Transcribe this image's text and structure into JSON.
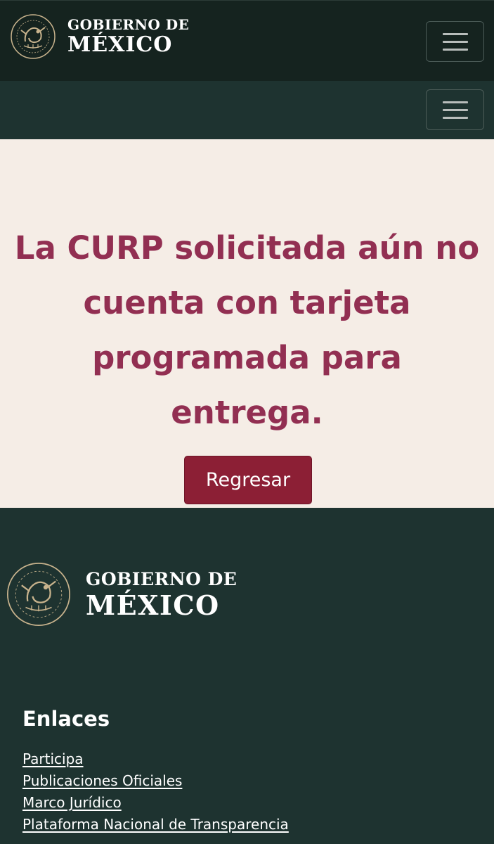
{
  "header": {
    "logo": {
      "line1": "GOBIERNO DE",
      "line2": "MÉXICO",
      "seal_text": "ESTADOS UNIDOS MEXICANOS"
    },
    "menu_icon": "hamburger-icon"
  },
  "main": {
    "message": "La CURP solicitada aún no cuenta con tarjeta programada para entrega.",
    "back_button": "Regresar"
  },
  "footer": {
    "logo": {
      "line1": "GOBIERNO DE",
      "line2": "MÉXICO",
      "seal_text": "ESTADOS UNIDOS MEXICANOS"
    },
    "links_title": "Enlaces",
    "links": [
      "Participa",
      "Publicaciones Oficiales",
      "Marco Jurídico",
      "Plataforma Nacional de Transparencia"
    ]
  },
  "colors": {
    "header_bg": "#15231f",
    "nav_bg": "#1e3330",
    "main_bg": "#f5ede6",
    "message_text": "#922f52",
    "button_bg": "#8c1f35",
    "seal_gold": "#c8b38d"
  }
}
